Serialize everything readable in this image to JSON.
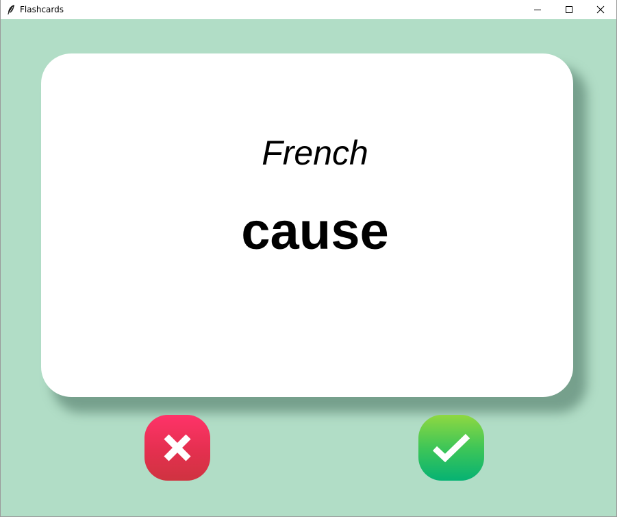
{
  "window": {
    "title": "Flashcards",
    "icons": {
      "app": "feather-icon",
      "minimize": "minimize-icon",
      "maximize": "maximize-icon",
      "close": "close-icon"
    }
  },
  "card": {
    "language": "French",
    "word": "cause"
  },
  "buttons": {
    "wrong_icon": "cross-icon",
    "right_icon": "check-icon"
  },
  "colors": {
    "background": "#b1ddc6",
    "card": "#ffffff",
    "wrong": "#e4304f",
    "right": "#3fc657"
  }
}
